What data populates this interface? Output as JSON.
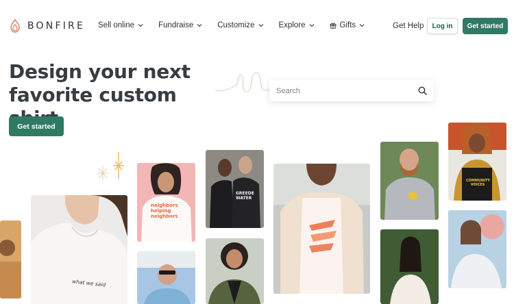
{
  "brand": {
    "name": "BONFIRE",
    "accent": "#2f7a63",
    "logo_color": "#e0856a"
  },
  "nav": {
    "items": [
      {
        "label": "Sell online",
        "dropdown": true,
        "icon": "chevron-down-icon"
      },
      {
        "label": "Fundraise",
        "dropdown": true,
        "icon": "chevron-down-icon"
      },
      {
        "label": "Customize",
        "dropdown": true,
        "icon": "chevron-down-icon"
      },
      {
        "label": "Explore",
        "dropdown": true,
        "icon": "chevron-down-icon"
      },
      {
        "label": "Gifts",
        "dropdown": true,
        "icon": "gift-icon"
      }
    ],
    "help": "Get Help",
    "login": "Log in",
    "get_started": "Get started"
  },
  "hero": {
    "headline": "Design your next favorite custom shirt",
    "cta": "Get started",
    "search_placeholder": "Search"
  },
  "photos": {
    "shirt_text_hoodie": "what we said",
    "shirt_text_neighbors": "neighbors helping neighbors",
    "shirt_text_water": "GREEDE WATER",
    "shirt_text_voices": "COMMUNITY VOICES"
  }
}
